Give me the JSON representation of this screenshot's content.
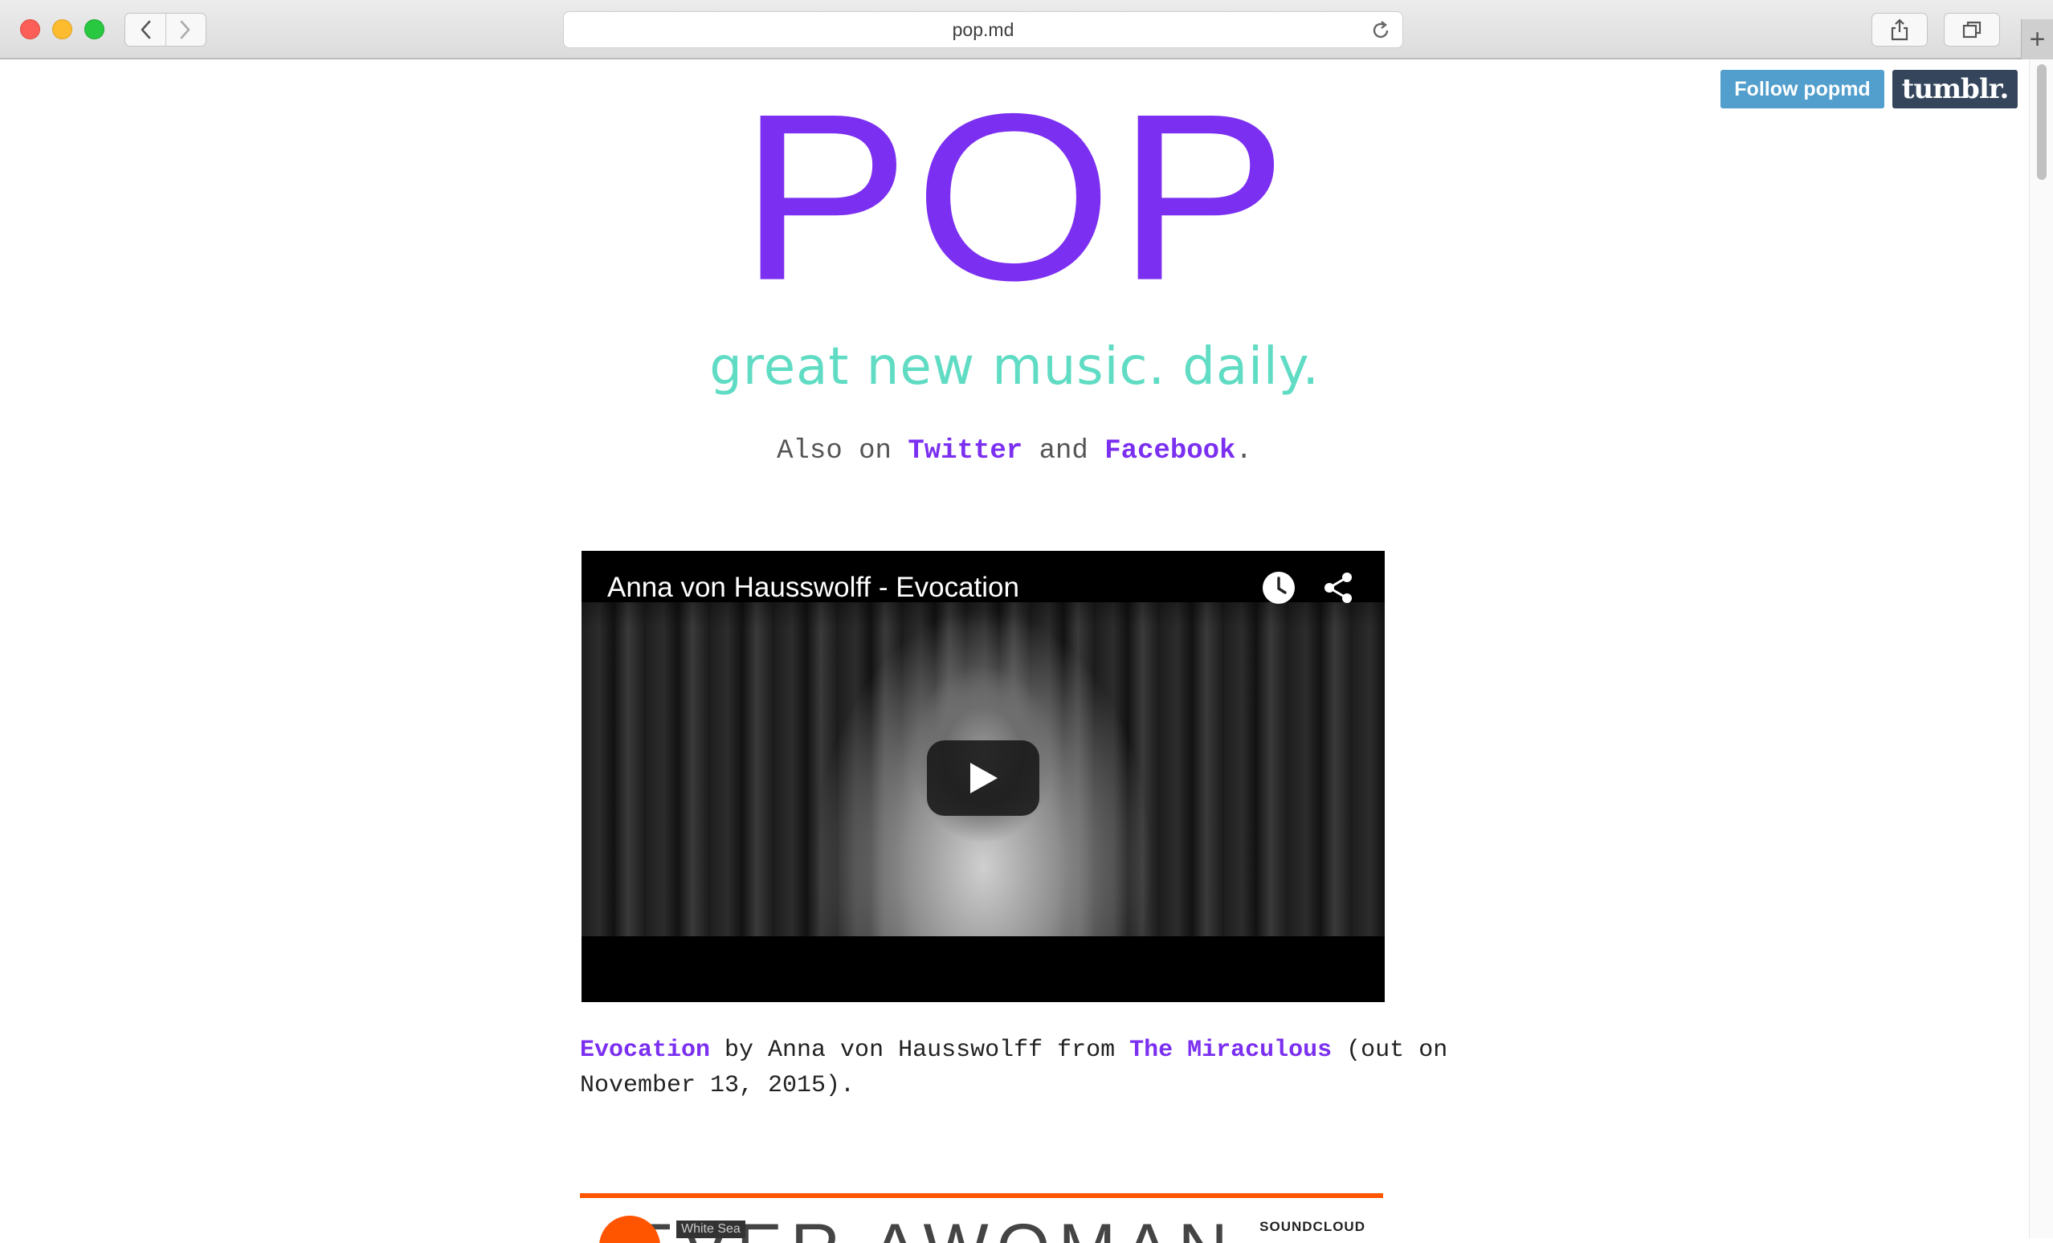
{
  "browser": {
    "url": "pop.md",
    "new_tab_label": "+"
  },
  "tumblr": {
    "follow_label": "Follow popmd",
    "brand_label": "tumblr."
  },
  "header": {
    "logo": "POP",
    "tagline": "great new music. daily.",
    "also_prefix": "Also on",
    "twitter_label": "Twitter",
    "and_word": "and",
    "facebook_label": "Facebook",
    "also_suffix": "."
  },
  "post": {
    "video_title": "Anna von Hausswolff - Evocation",
    "song_link": "Evocation",
    "by_text": " by Anna von Hausswolff from ",
    "album_link": "The Miraculous",
    "release_text": " (out on November 13, 2015)."
  },
  "next_post": {
    "art_text": "EVER AWOMAN",
    "track_label": "White Sea",
    "provider": "SOUNDCLOUD"
  },
  "colors": {
    "brand_purple": "#7b2ff0",
    "tagline_teal": "#5fdcc3",
    "soundcloud_orange": "#ff5500",
    "tumblr_follow": "#529ecc",
    "tumblr_brand": "#35465c"
  },
  "icons": [
    "back-icon",
    "forward-icon",
    "reload-icon",
    "share-icon",
    "tabs-icon",
    "clock-icon",
    "play-icon"
  ]
}
